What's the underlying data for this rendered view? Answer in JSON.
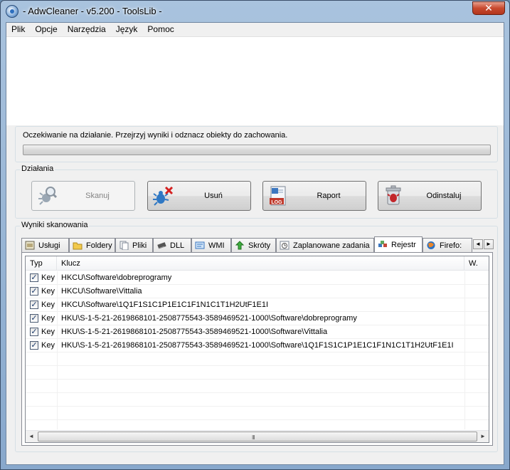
{
  "window": {
    "title": "- AdwCleaner - v5.200 - ToolsLib -",
    "close_label": "✕"
  },
  "menu": [
    {
      "label": "Plik"
    },
    {
      "label": "Opcje"
    },
    {
      "label": "Narzędzia"
    },
    {
      "label": "Język"
    },
    {
      "label": "Pomoc"
    }
  ],
  "status": {
    "text": "Oczekiwanie na działanie. Przejrzyj wyniki i odznacz obiekty do zachowania.",
    "progress": 0
  },
  "actions": {
    "label": "Działania",
    "buttons": [
      {
        "label": "Skanuj",
        "icon": "magnifier-bug-icon",
        "enabled": false
      },
      {
        "label": "Usuń",
        "icon": "bug-delete-icon",
        "enabled": true
      },
      {
        "label": "Raport",
        "icon": "log-report-icon",
        "enabled": true
      },
      {
        "label": "Odinstaluj",
        "icon": "trash-uninstall-icon",
        "enabled": true
      }
    ]
  },
  "results": {
    "label": "Wyniki skanowania",
    "tabs": [
      {
        "label": "Usługi",
        "icon": "services-icon"
      },
      {
        "label": "Foldery",
        "icon": "folder-icon"
      },
      {
        "label": "Pliki",
        "icon": "files-icon"
      },
      {
        "label": "DLL",
        "icon": "dll-chip-icon"
      },
      {
        "label": "WMI",
        "icon": "wmi-icon"
      },
      {
        "label": "Skróty",
        "icon": "shortcut-arrow-icon"
      },
      {
        "label": "Zaplanowane zadania",
        "icon": "scheduled-task-icon"
      },
      {
        "label": "Rejestr",
        "icon": "registry-icon",
        "active": true
      },
      {
        "label": "Firefo:",
        "icon": "firefox-globe-icon"
      }
    ],
    "columns": {
      "type": "Typ",
      "key": "Klucz",
      "extra": "W."
    },
    "rows": [
      {
        "checked": true,
        "type": "Key",
        "key": "HKCU\\Software\\dobreprogramy"
      },
      {
        "checked": true,
        "type": "Key",
        "key": "HKCU\\Software\\Vittalia"
      },
      {
        "checked": true,
        "type": "Key",
        "key": "HKCU\\Software\\1Q1F1S1C1P1E1C1F1N1C1T1H2UtF1E1I"
      },
      {
        "checked": true,
        "type": "Key",
        "key": "HKU\\S-1-5-21-2619868101-2508775543-3589469521-1000\\Software\\dobreprogramy"
      },
      {
        "checked": true,
        "type": "Key",
        "key": "HKU\\S-1-5-21-2619868101-2508775543-3589469521-1000\\Software\\Vittalia"
      },
      {
        "checked": true,
        "type": "Key",
        "key": "HKU\\S-1-5-21-2619868101-2508775543-3589469521-1000\\Software\\1Q1F1S1C1P1E1C1F1N1C1T1H2UtF1E1I"
      }
    ],
    "scroll": {
      "left": "◄",
      "right": "►",
      "grip": "III"
    }
  },
  "colors": {
    "accent_red": "#d42020",
    "title_bar": "#a9c3de",
    "check": "#1b3a6b"
  }
}
